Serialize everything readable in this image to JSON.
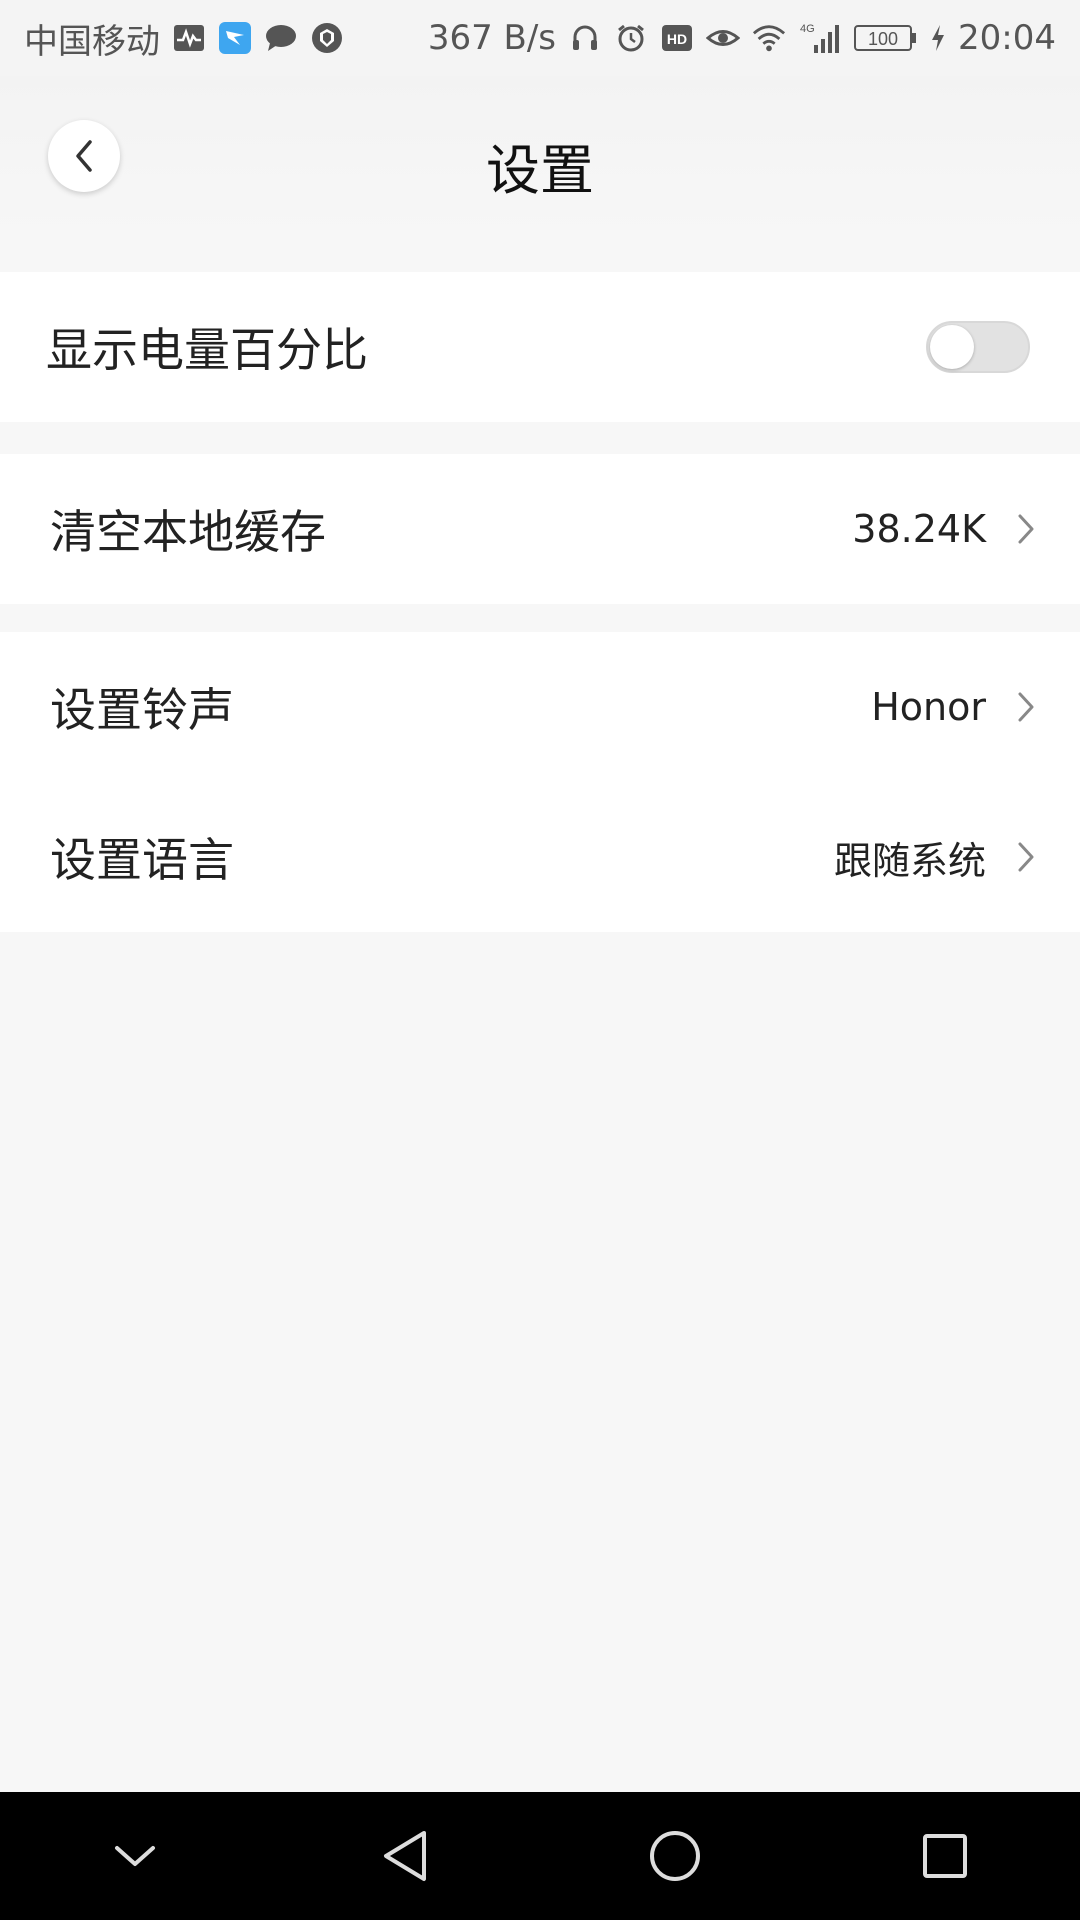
{
  "status_bar": {
    "carrier": "中国移动",
    "speed": "367 B/s",
    "battery": "100",
    "time": "20:04",
    "network": "4G",
    "icons_left": [
      "activity-icon",
      "app-notification-icon",
      "message-icon",
      "shield-icon"
    ],
    "icons_right": [
      "headphones-icon",
      "alarm-icon",
      "hd-icon",
      "eye-icon",
      "wifi-icon",
      "signal-icon",
      "battery-icon",
      "charging-icon"
    ]
  },
  "header": {
    "title": "设置"
  },
  "settings": {
    "battery_percent": {
      "label": "显示电量百分比",
      "enabled": false
    },
    "clear_cache": {
      "label": "清空本地缓存",
      "value": "38.24K"
    },
    "ringtone": {
      "label": "设置铃声",
      "value": "Honor"
    },
    "language": {
      "label": "设置语言",
      "value": "跟随系统"
    }
  },
  "nav_bar": {
    "icons": [
      "collapse-icon",
      "back-icon",
      "home-icon",
      "recents-icon"
    ]
  },
  "colors": {
    "background": "#f7f7f7",
    "card": "#ffffff",
    "navbar": "#000000",
    "toggle_off": "#e2e2e2"
  }
}
